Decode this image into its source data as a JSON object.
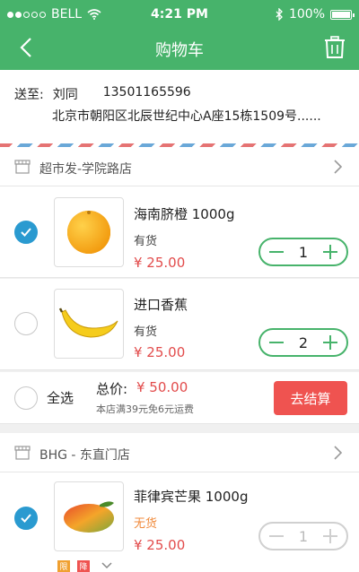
{
  "status_bar": {
    "carrier": "BELL",
    "time": "4:21 PM",
    "battery": "100%"
  },
  "header": {
    "title": "购物车"
  },
  "address": {
    "label": "送至:",
    "name": "刘同",
    "phone": "13501165596",
    "detail": "北京市朝阳区北辰世纪中心A座15栋1509号......"
  },
  "stores": [
    {
      "name": "超市发-学院路店",
      "items": [
        {
          "name": "海南脐橙  1000g",
          "stock": "有货",
          "price": "¥ 25.00",
          "qty": "1",
          "checked": true
        },
        {
          "name": "进口香蕉",
          "stock": "有货",
          "price": "¥ 25.00",
          "qty": "2",
          "checked": false
        }
      ],
      "summary": {
        "select_all": "全选",
        "total_label": "总价:",
        "total_value": "¥ 50.00",
        "shipping_note": "本店满39元免6元运费",
        "checkout": "去结算"
      }
    },
    {
      "name": "BHG - 东直门店",
      "items": [
        {
          "name": "菲律宾芒果  1000g",
          "stock": "无货",
          "price": "¥ 25.00",
          "qty": "1",
          "checked": true,
          "tags": [
            "限",
            "降"
          ]
        }
      ]
    }
  ],
  "colors": {
    "brand_green": "#47b36b",
    "price_red": "#e24b4b",
    "checkbox_blue": "#2a9ad0",
    "checkout_red": "#ef5350",
    "out_of_stock": "#f08a3b"
  },
  "icons": {
    "back": "chevron-left-icon",
    "delete": "trash-icon",
    "store": "store-icon",
    "chevron": "chevron-right-icon",
    "wifi": "wifi-icon",
    "bluetooth": "bluetooth-icon",
    "battery": "battery-icon"
  }
}
